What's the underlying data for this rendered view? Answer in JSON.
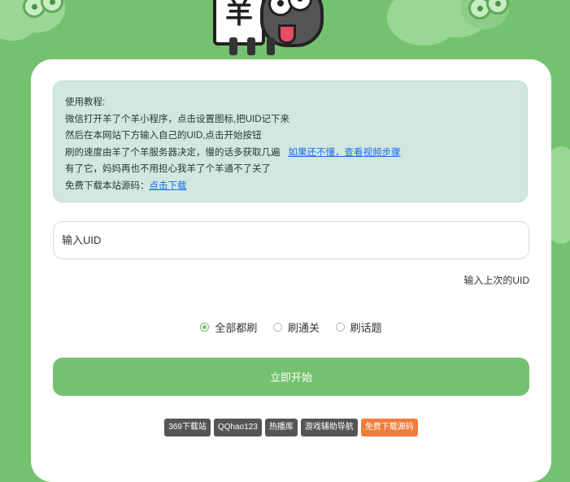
{
  "mascot": {
    "board_char": "羊"
  },
  "notice": {
    "lines": [
      "使用教程:",
      "微信打开羊了个羊小程序，点击设置图标,把UID记下来",
      "然后在本网站下方输入自己的UID,点击开始按钮",
      "刷的速度由羊了个羊服务器决定，慢的话多获取几遍",
      "有了它，妈妈再也不用担心我羊了个羊通不了关了",
      "免费下载本站源码："
    ],
    "video_link": "如果还不懂，查看视频步骤",
    "download_link": "点击下载"
  },
  "uid_input": {
    "placeholder": "输入UID",
    "value": ""
  },
  "last_uid_label": "输入上次的UID",
  "modes": {
    "selected": "全部都刷",
    "options": [
      "全部都刷",
      "刷通关",
      "刷话题"
    ]
  },
  "start_button": "立即开始",
  "footer_links": [
    {
      "label": "369下载站",
      "color": "#555555"
    },
    {
      "label": "QQhao123",
      "color": "#555555"
    },
    {
      "label": "热播库",
      "color": "#555555"
    },
    {
      "label": "游戏辅助导航",
      "color": "#555555"
    },
    {
      "label": "免费下载源码",
      "color": "#f07c3a"
    }
  ],
  "colors": {
    "accent": "#74c270",
    "notice_bg": "#d1e7df",
    "link": "#1a6fe0"
  }
}
